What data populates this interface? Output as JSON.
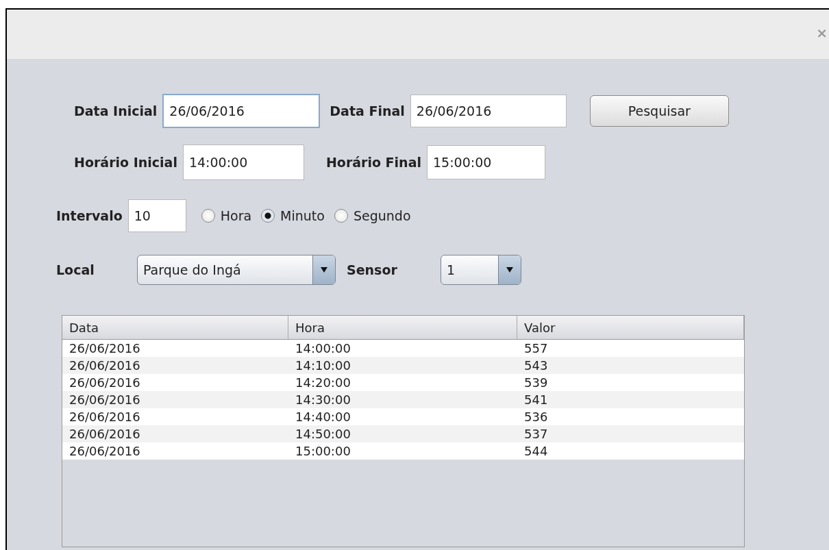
{
  "window": {
    "close": "×"
  },
  "dates": {
    "start_label": "Data Inicial",
    "start_value": "26/06/2016",
    "start_focused": true,
    "end_label": "Data Final",
    "end_value": "26/06/2016",
    "search_button": "Pesquisar"
  },
  "times": {
    "start_label": "Horário Inicial",
    "start_value": "14:00:00",
    "end_label": "Horário Final",
    "end_value": "15:00:00"
  },
  "interval": {
    "label": "Intervalo",
    "value": "10",
    "units": [
      {
        "label": "Hora",
        "selected": false
      },
      {
        "label": "Minuto",
        "selected": true
      },
      {
        "label": "Segundo",
        "selected": false
      }
    ]
  },
  "location": {
    "label": "Local",
    "value": "Parque do Ingá",
    "sensor_label": "Sensor",
    "sensor_value": "1"
  },
  "table": {
    "columns": [
      "Data",
      "Hora",
      "Valor"
    ],
    "rows": [
      [
        "26/06/2016",
        "14:00:00",
        "557"
      ],
      [
        "26/06/2016",
        "14:10:00",
        "543"
      ],
      [
        "26/06/2016",
        "14:20:00",
        "539"
      ],
      [
        "26/06/2016",
        "14:30:00",
        "541"
      ],
      [
        "26/06/2016",
        "14:40:00",
        "536"
      ],
      [
        "26/06/2016",
        "14:50:00",
        "537"
      ],
      [
        "26/06/2016",
        "15:00:00",
        "544"
      ]
    ]
  }
}
